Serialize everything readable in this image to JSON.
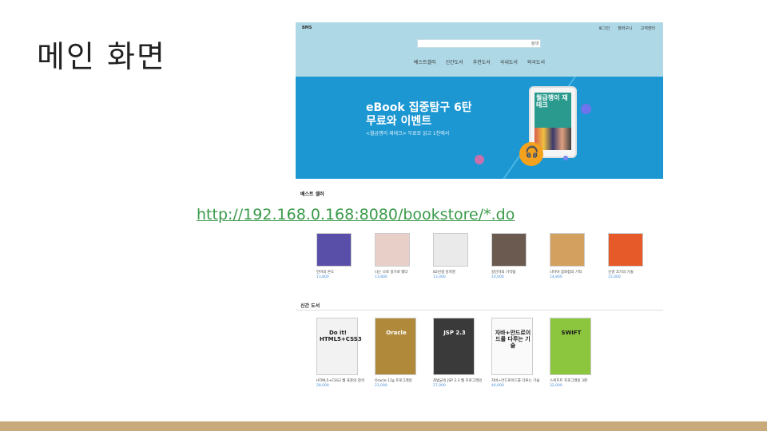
{
  "slide": {
    "title": "메인 화면",
    "url": "http://192.168.0.168:8080/bookstore/*.do"
  },
  "site": {
    "logo": "BMS",
    "top_links": [
      "로그인",
      "장바구니",
      "고객센터"
    ],
    "search_button": "검색",
    "menu": [
      "베스트셀러",
      "신간도서",
      "추천도서",
      "국내도서",
      "외국도서"
    ],
    "banner": {
      "title_line1": "eBook 집중탐구 6탄",
      "title_line2": "무료와 이벤트",
      "subtitle": "<월급쟁이 재테크> 무료로 읽고 1천에서",
      "tablet_text": "월급쟁이 재테크"
    },
    "bestseller": {
      "title": "베스트 셀러",
      "books": [
        {
          "title": "언어의 온도",
          "price": "13,800",
          "color": "#5a4fa8"
        },
        {
          "title": "나는 나로 살기로 했다",
          "price": "13,800",
          "color": "#e8cfc8"
        },
        {
          "title": "82년생 김지영",
          "price": "13,000",
          "color": "#eaeaea"
        },
        {
          "title": "살인자의 기억법",
          "price": "10,000",
          "color": "#6a5a50"
        },
        {
          "title": "나미야 잡화점의 기적",
          "price": "14,800",
          "color": "#d4a060"
        },
        {
          "title": "신경 끄기의 기술",
          "price": "15,000",
          "color": "#e65a2a"
        }
      ]
    },
    "newbooks": {
      "title": "신간 도서",
      "books": [
        {
          "title": "HTML5+CSS3 웹 표준의 정석",
          "price": "28,000",
          "color": "#f2f2f2",
          "cover_text": "Do it! HTML5+CSS3"
        },
        {
          "title": "Oracle 11g 프로그래밍",
          "price": "23,000",
          "color": "#b08a3a",
          "cover_text": "Oracle"
        },
        {
          "title": "최범균의 JSP 2.3 웹 프로그래밍",
          "price": "27,000",
          "color": "#3a3a3a",
          "cover_text": "JSP 2.3"
        },
        {
          "title": "자바+안드로이드를 다루는 기술",
          "price": "40,000",
          "color": "#fafafa",
          "cover_text": "자바+안드로이드를 다루는 기술"
        },
        {
          "title": "스위프트 프로그래밍 3판",
          "price": "32,000",
          "color": "#8cc63f",
          "cover_text": "SWIFT"
        }
      ]
    }
  }
}
